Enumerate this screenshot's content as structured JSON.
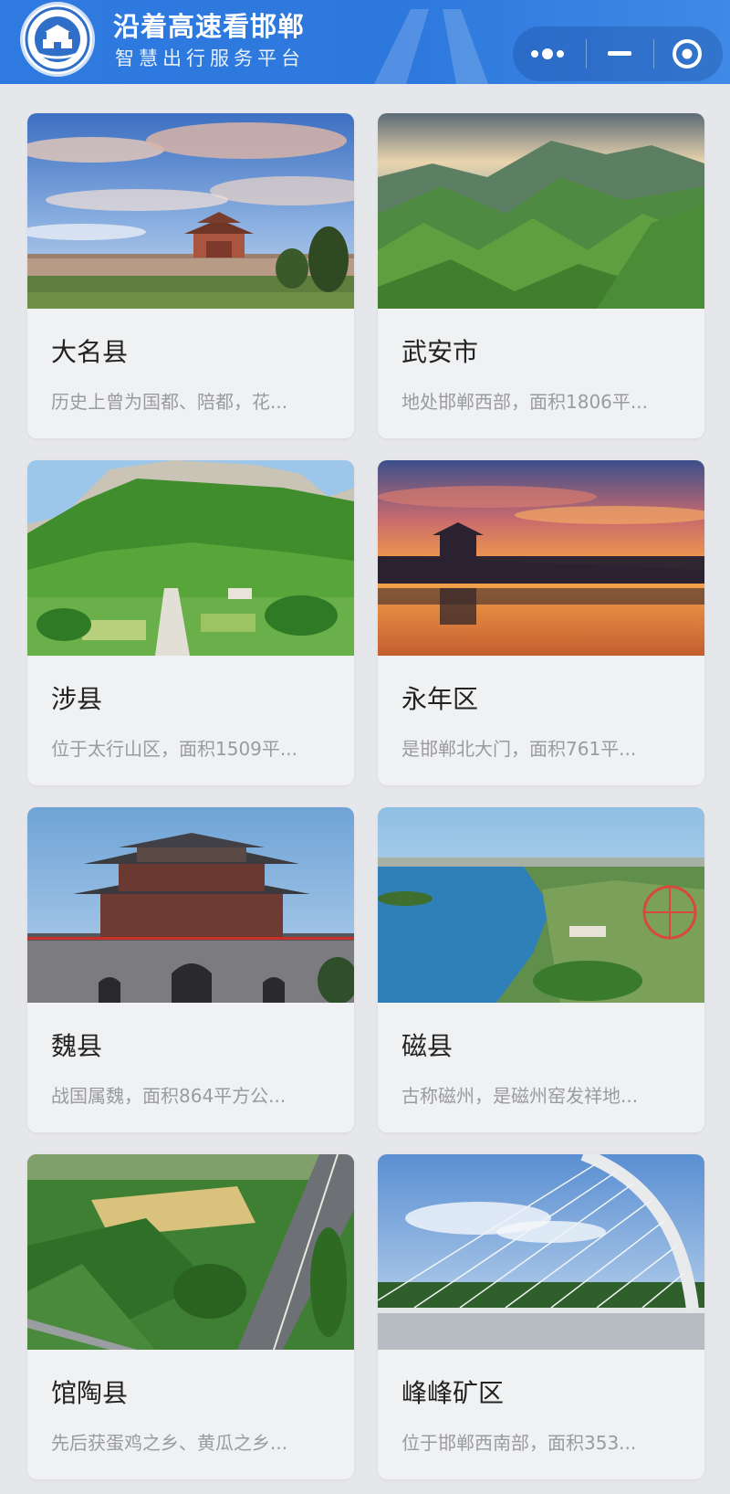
{
  "header": {
    "title": "沿着高速看邯郸",
    "subtitle": "智慧出行服务平台",
    "logo_icon": "emblem-logo-icon",
    "capsule": {
      "more_icon": "more-dots-icon",
      "minimize_icon": "minimize-icon",
      "close_icon": "target-close-icon"
    }
  },
  "cards": [
    {
      "name": "大名县",
      "desc": "历史上曾为国都、陪都，花...",
      "image": "ancient-city-wall-gate-under-dramatic-clouds"
    },
    {
      "name": "武安市",
      "desc": "地处邯郸西部，面积1806平...",
      "image": "green-mountain-ranges"
    },
    {
      "name": "涉县",
      "desc": "位于太行山区，面积1509平...",
      "image": "green-mountain-cliff-with-garden"
    },
    {
      "name": "永年区",
      "desc": "是邯郸北大门，面积761平...",
      "image": "city-wall-sunset-reflection"
    },
    {
      "name": "魏县",
      "desc": "战国属魏，面积864平方公...",
      "image": "traditional-tower-gate"
    },
    {
      "name": "磁县",
      "desc": "古称磁州，是磁州窑发祥地...",
      "image": "lake-with-ferris-wheel-aerial"
    },
    {
      "name": "馆陶县",
      "desc": "先后获蛋鸡之乡、黄瓜之乡...",
      "image": "aerial-farmland-and-highway"
    },
    {
      "name": "峰峰矿区",
      "desc": "位于邯郸西南部，面积353...",
      "image": "arch-cable-bridge"
    }
  ],
  "colors": {
    "header": "#2f7ae0",
    "background": "#e6e7ea",
    "card": "#f0f1f3",
    "name_text": "#222222",
    "desc_text": "#9a9b9e"
  }
}
